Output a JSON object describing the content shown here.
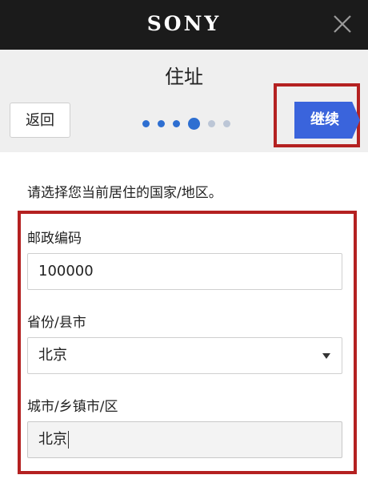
{
  "topbar": {
    "logo": "SONY",
    "close_icon": "close-icon"
  },
  "header": {
    "title": "住址",
    "back_label": "返回",
    "continue_label": "继续"
  },
  "progress": {
    "total_steps": 6,
    "current_step": 4
  },
  "form": {
    "instruction": "请选择您当前居住的国家/地区。",
    "postal_label": "邮政编码",
    "postal_value": "100000",
    "province_label": "省份/县市",
    "province_value": "北京",
    "city_label": "城市/乡镇市/区",
    "city_value": "北京"
  },
  "colors": {
    "accent": "#3a64dc",
    "highlight": "#b42121",
    "topbar": "#1b1b1b"
  }
}
